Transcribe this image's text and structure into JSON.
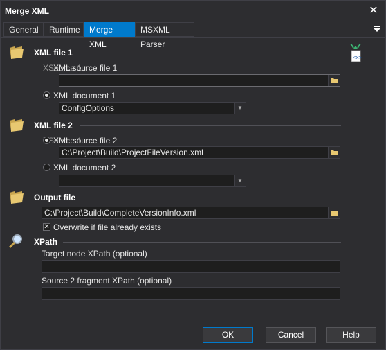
{
  "window": {
    "title": "Merge XML",
    "close_symbol": "✕"
  },
  "tabs": [
    {
      "label": "General"
    },
    {
      "label": "Runtime"
    },
    {
      "label": "Merge XML"
    },
    {
      "label": "MSXML Parser"
    }
  ],
  "xml_file_1": {
    "title": "XML file 1",
    "option_source_label": "XML source file 1",
    "option_source_overlap": "XSource 1",
    "source_value": "",
    "option_document_label": "XML document 1",
    "document_value": "ConfigOptions"
  },
  "xml_file_2": {
    "title": "XML file 2",
    "option_source_label": "XML source file 2",
    "option_source_overlap": "XSource 1",
    "source_value": "C:\\Project\\Build\\ProjectFileVersion.xml",
    "option_document_label": "XML document 2",
    "document_value": ""
  },
  "output_file": {
    "title": "Output file",
    "path_value": "C:\\Project\\Build\\CompleteVersionInfo.xml",
    "overwrite_label": "Overwrite if file already exists",
    "overwrite_mark": "✕"
  },
  "xpath": {
    "title": "XPath",
    "target_label": "Target node XPath (optional)",
    "target_value": "",
    "source2_label": "Source 2 fragment XPath (optional)",
    "source2_value": ""
  },
  "buttons": {
    "ok": "OK",
    "cancel": "Cancel",
    "help": "Help"
  },
  "colors": {
    "accent": "#007acc",
    "background": "#2d2d30",
    "field": "#1e1e1e",
    "folder": "#e8c871"
  }
}
